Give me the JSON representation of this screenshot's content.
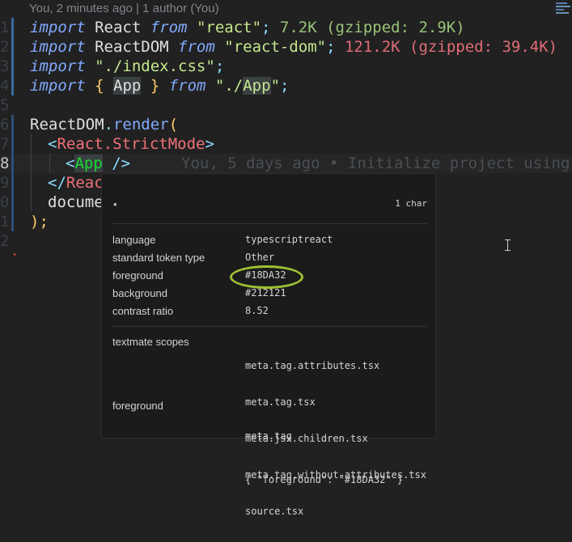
{
  "editor": {
    "blame_header": "You, 2 minutes ago | 1 author (You)",
    "line_numbers": [
      "1",
      "2",
      "3",
      "4",
      "5",
      "6",
      "7",
      "8",
      "9",
      "0",
      "1",
      "2"
    ],
    "inline_blame": "You, 5 days ago • Initialize project using",
    "lines": {
      "l1": {
        "kw1": "import",
        "id": " React ",
        "kw2": "from",
        "sp": " ",
        "str": "\"react\"",
        "semi": ";",
        "size": " 7.2K (gzipped: 2.9K)"
      },
      "l2": {
        "kw1": "import",
        "id": " ReactDOM ",
        "kw2": "from",
        "sp": " ",
        "str": "\"react-dom\"",
        "semi": ";",
        "size": " 121.2K (gzipped: 39.4K)"
      },
      "l3": {
        "kw1": "import",
        "sp": " ",
        "str": "\"./index.css\"",
        "semi": ";"
      },
      "l4": {
        "kw1": "import",
        "sp1": " ",
        "lb": "{",
        "sp2": " ",
        "app": "App",
        "sp3": " ",
        "rb": "}",
        "sp4": " ",
        "kw2": "from",
        "sp5": " ",
        "q1": "\"./",
        "app2": "App",
        "q2": "\"",
        "semi": ";"
      },
      "l6": {
        "obj": "ReactDOM",
        "dot": ".",
        "fn": "render",
        "paren": "("
      },
      "l7": {
        "lt": "<",
        "tag": "React.StrictMode",
        "gt": ">"
      },
      "l8": {
        "lt": "<",
        "tag": "App",
        "rest": " />"
      },
      "l9": {
        "lt": "</",
        "tag": "Reac"
      },
      "l10": {
        "text": "docume"
      },
      "l11": {
        "text": ");"
      }
    }
  },
  "hover": {
    "header": "•",
    "length": "1 char",
    "props": [
      {
        "k": "language",
        "v": "typescriptreact"
      },
      {
        "k": "standard token type",
        "v": "Other"
      },
      {
        "k": "foreground",
        "v": "#18DA32"
      },
      {
        "k": "background",
        "v": "#212121"
      },
      {
        "k": "contrast ratio",
        "v": "8.52"
      }
    ],
    "scopes_label": "textmate scopes",
    "scopes": [
      "meta.tag.attributes.tsx",
      "meta.tag.tsx",
      "meta.jsx.children.tsx",
      "meta.tag.without-attributes.tsx",
      "source.tsx"
    ],
    "fg_label": "foreground",
    "fg_rule": "meta.tag",
    "fg_json": "{ \"foreground\": \"#18DA32\" }"
  },
  "colors": {
    "background": "#212121",
    "keyword": "#82aaff",
    "string": "#c3e88d",
    "jsx_tag": "#18da32",
    "highlight_ring": "#9ec132"
  }
}
